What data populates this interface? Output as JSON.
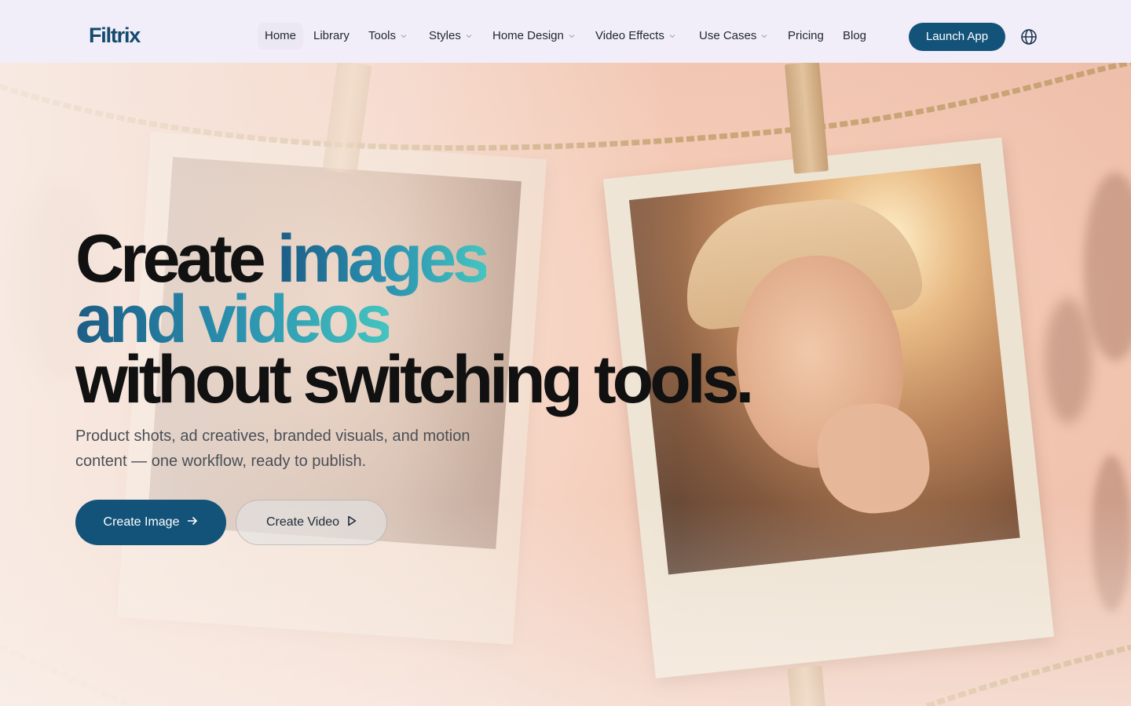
{
  "brand": {
    "logo": "Filtrix"
  },
  "nav": {
    "items": [
      {
        "label": "Home",
        "active": true,
        "dropdown": false
      },
      {
        "label": "Library",
        "dropdown": false
      },
      {
        "label": "Tools",
        "dropdown": true
      },
      {
        "label": "Styles",
        "dropdown": true
      },
      {
        "label": "Home Design",
        "dropdown": true
      },
      {
        "label": "Video Effects",
        "dropdown": true
      },
      {
        "label": "Use Cases",
        "dropdown": true
      },
      {
        "label": "Pricing",
        "dropdown": false
      },
      {
        "label": "Blog",
        "dropdown": false
      }
    ],
    "launch_label": "Launch App",
    "language_icon": "globe-icon"
  },
  "hero": {
    "headline": {
      "line1_plain": "Create",
      "line1_accent": "images",
      "line2_accent": "and videos",
      "line3": "without switching tools."
    },
    "subtitle_line1": "Product shots, ad creatives, branded visuals, and motion",
    "subtitle_line2": "content — one workflow, ready to publish.",
    "primary_button": {
      "label": "Create Image",
      "icon": "arrow-right-icon"
    },
    "secondary_button": {
      "label": "Create Video",
      "icon": "play-icon"
    }
  },
  "colors": {
    "brand": "#145379",
    "accent_gradient_start": "#1c5d86",
    "accent_gradient_end": "#44c4c0",
    "nav_bg": "#f2eef9"
  }
}
